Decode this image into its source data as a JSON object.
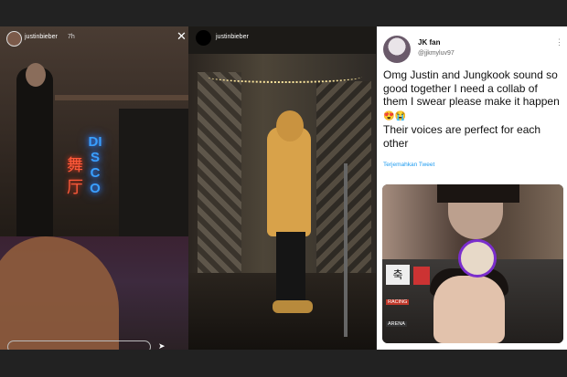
{
  "story1": {
    "username": "justinbieber",
    "time": "7h",
    "close_glyph": "✕",
    "neon_text": "DISCO",
    "neon_chinese": "舞厅"
  },
  "story2": {
    "username": "justinbieber"
  },
  "tweet": {
    "display_name": "JK fan",
    "handle": "@jjkmyluv97",
    "more_glyph": "⋮",
    "line1": "Omg Justin and Jungkook sound so good together I need a collab of them I swear please make it happen",
    "emojis": "😍😭",
    "line2": "Their voices are perfect for each other",
    "translate_label": "Terjemahkan Tweet",
    "media_sign": "축",
    "media_label1": "RACING",
    "media_label2": "ARENA"
  },
  "colors": {
    "neon_blue": "#3aa0ff",
    "neon_red": "#ff5a3a",
    "link_blue": "#1d9bf0"
  }
}
